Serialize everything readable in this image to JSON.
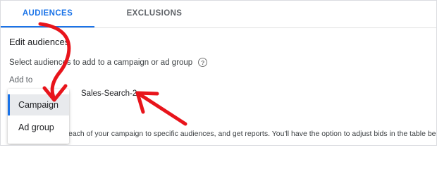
{
  "tabs": {
    "audiences": "AUDIENCES",
    "exclusions": "EXCLUSIONS"
  },
  "section": {
    "title": "Edit audiences",
    "instruction": "Select audiences to add to a campaign or ad group",
    "help_icon": "?"
  },
  "add_to": {
    "label": "Add to",
    "campaign_value": "Sales-Search-2"
  },
  "menu": {
    "items": [
      "Campaign",
      "Ad group"
    ],
    "selected": "Campaign"
  },
  "description_text": "each of your campaign to specific audiences, and get reports. You'll have the option to adjust bids in the table below.",
  "colors": {
    "accent": "#1a73e8",
    "annotation": "#e8141b",
    "text": "#202124"
  },
  "icons": {
    "help": "help-circle-icon"
  }
}
